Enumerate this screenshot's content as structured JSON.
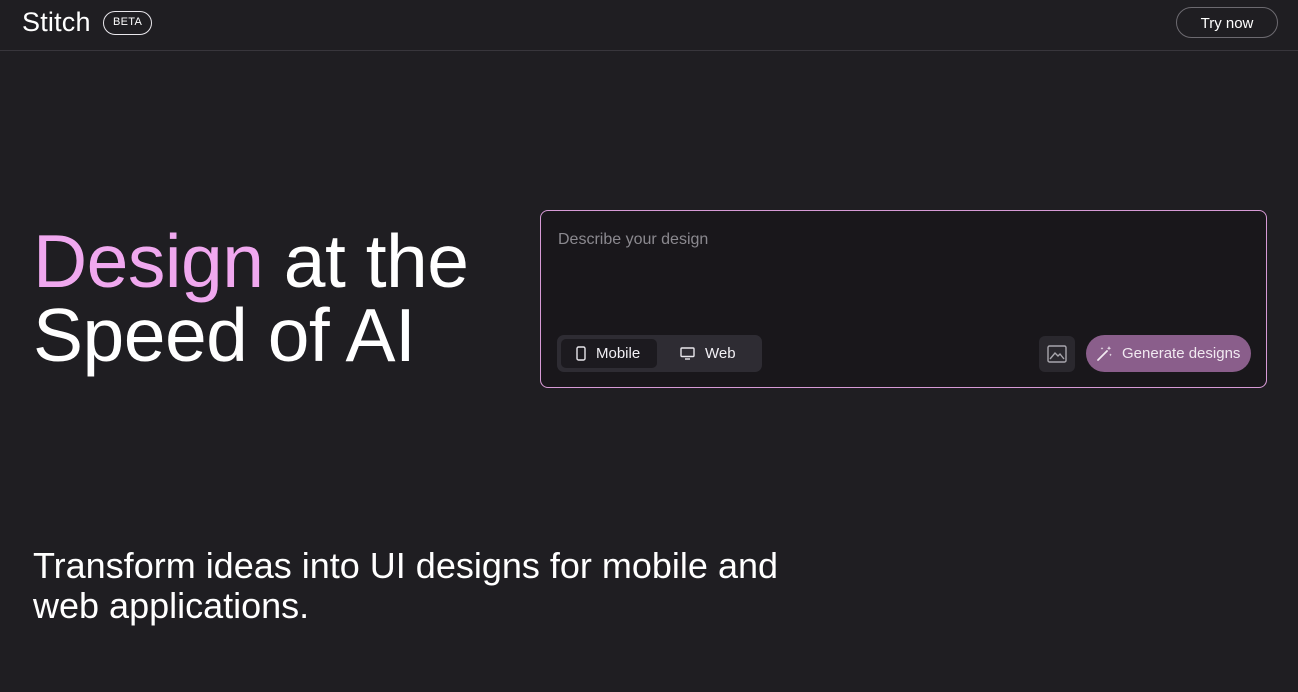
{
  "header": {
    "brand": "Stitch",
    "badge": "BETA",
    "try_now_label": "Try now"
  },
  "hero": {
    "headline_accent": "Design",
    "headline_line1_rest": " at the",
    "headline_line2": "Speed of AI",
    "accent_color": "#f0a8ef"
  },
  "prompt": {
    "placeholder": "Describe your design",
    "value": "",
    "mode_options": [
      {
        "label": "Mobile",
        "icon": "phone-icon",
        "selected": true
      },
      {
        "label": "Web",
        "icon": "monitor-icon",
        "selected": false
      }
    ],
    "image_button_icon": "image-icon",
    "generate_label": "Generate designs",
    "generate_icon": "magic-wand-icon"
  },
  "subheading": {
    "line1": "Transform ideas into UI designs for mobile and",
    "line2": "web applications."
  }
}
